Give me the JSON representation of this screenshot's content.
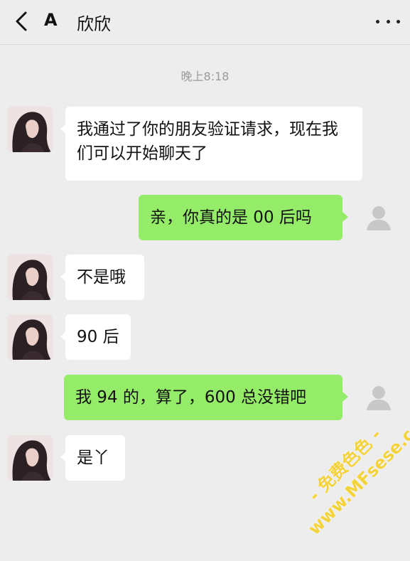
{
  "header": {
    "back_icon": "chevron-left-icon",
    "prefix": "A",
    "contact_name": "欣欣",
    "more_icon": "more-dots-icon"
  },
  "timestamp": "晚上8:18",
  "messages": [
    {
      "side": "left",
      "text": "我通过了你的朋友验证请求，现在我们可以开始聊天了"
    },
    {
      "side": "right",
      "text": "亲，你真的是 00 后吗"
    },
    {
      "side": "left",
      "text": "不是哦"
    },
    {
      "side": "left",
      "text": "90 后"
    },
    {
      "side": "right",
      "text": "我 94 的，算了，600 总没错吧"
    },
    {
      "side": "left",
      "text": "是丫"
    }
  ],
  "watermark": {
    "line1": "- 免费色色 -",
    "line2": "www.MFsese.com"
  },
  "colors": {
    "background": "#ededed",
    "incoming_bubble": "#ffffff",
    "outgoing_bubble": "#95ec69",
    "watermark": "#f4d33a"
  }
}
